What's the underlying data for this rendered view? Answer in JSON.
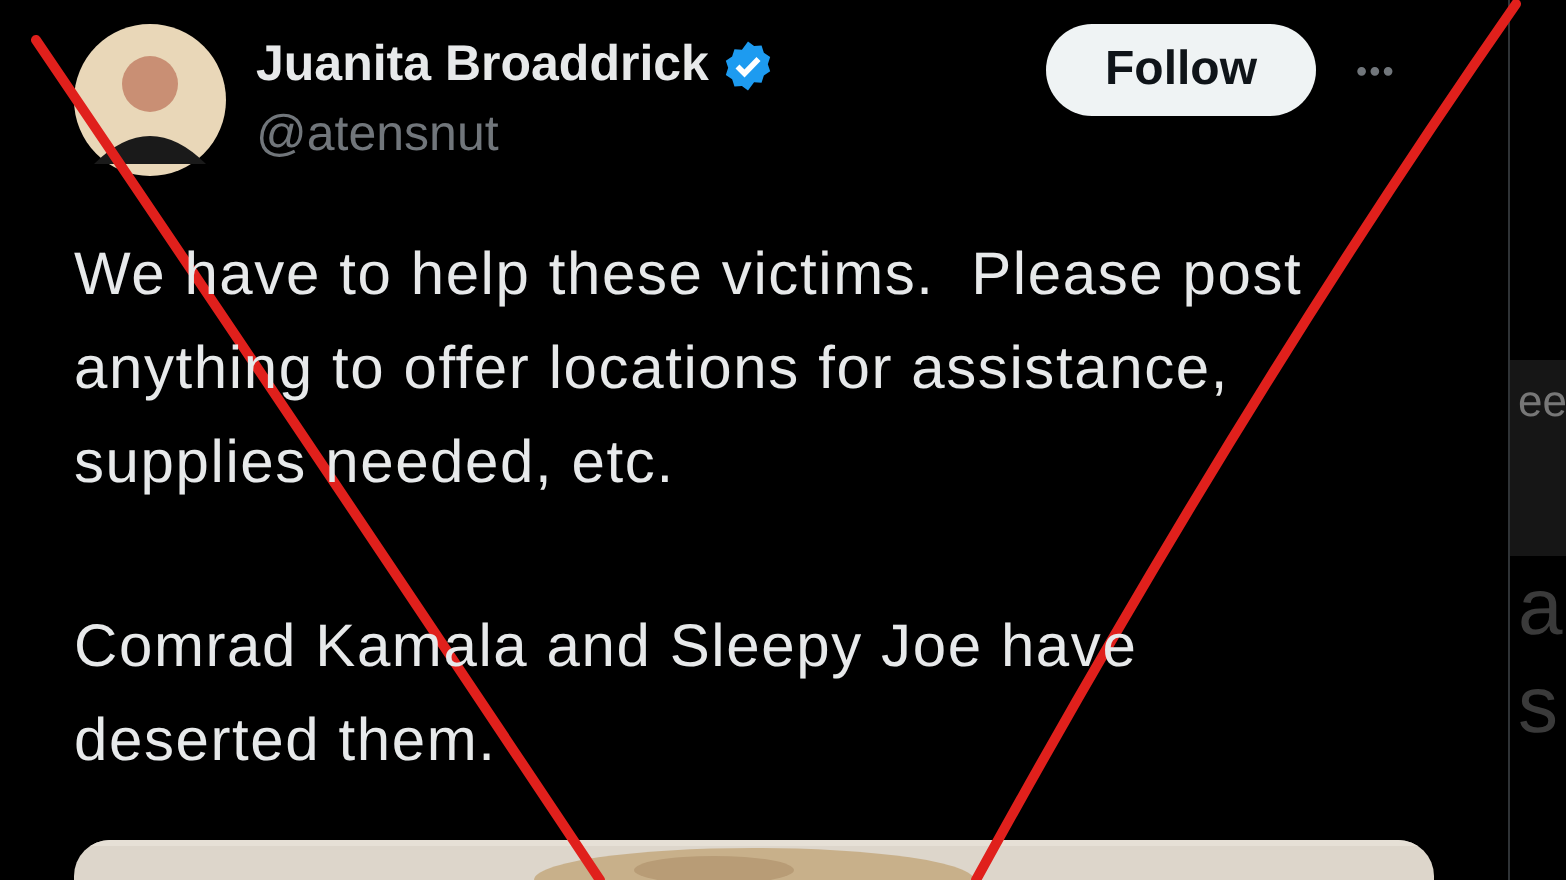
{
  "post": {
    "author": {
      "name": "Juanita Broaddrick",
      "handle": "@atensnut",
      "verified": true
    },
    "follow_button": "Follow",
    "more": "•••",
    "paragraphs": [
      [
        "We have to help these victims.  Please post",
        "anything to offer locations for assistance,",
        "supplies needed, etc."
      ],
      [
        "Comrad Kamala and Sleepy Joe have",
        "deserted them."
      ]
    ],
    "media": {
      "kind": "picture"
    }
  },
  "side_panel": {
    "texts": [
      "ee",
      "a",
      "s"
    ]
  }
}
